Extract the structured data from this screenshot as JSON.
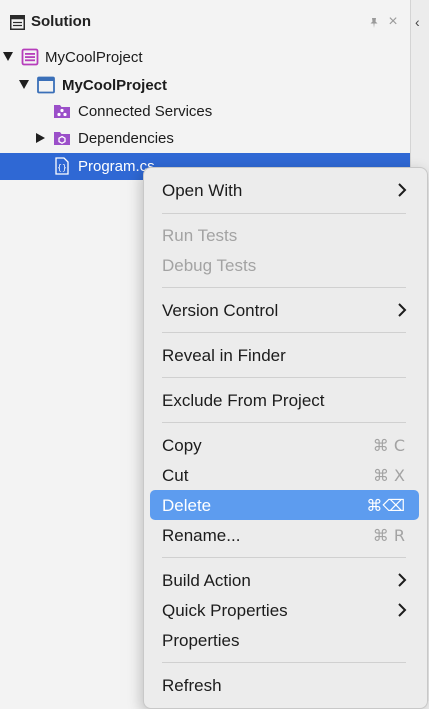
{
  "pad": {
    "title": "Solution",
    "pin_glyph": "📌",
    "close_glyph": "×",
    "right_chevron": "‹"
  },
  "tree": {
    "solution_label": "MyCoolProject",
    "project_label": "MyCoolProject",
    "connected_services_label": "Connected Services",
    "dependencies_label": "Dependencies",
    "program_label": "Program.cs"
  },
  "colors": {
    "selection": "#2f68d4",
    "menu_highlight": "#5d9cef",
    "solution_icon": "#b63dbb",
    "folder_icon": "#9b4fc9"
  },
  "menu": {
    "open_with": "Open With",
    "run_tests": "Run Tests",
    "debug_tests": "Debug Tests",
    "version_control": "Version Control",
    "reveal_in_finder": "Reveal in Finder",
    "exclude_from_project": "Exclude From Project",
    "copy": "Copy",
    "copy_shortcut": "⌘ C",
    "cut": "Cut",
    "cut_shortcut": "⌘ X",
    "delete": "Delete",
    "delete_shortcut": "⌘⌫",
    "rename": "Rename...",
    "rename_shortcut": "⌘ R",
    "build_action": "Build Action",
    "quick_properties": "Quick Properties",
    "properties": "Properties",
    "refresh": "Refresh"
  }
}
